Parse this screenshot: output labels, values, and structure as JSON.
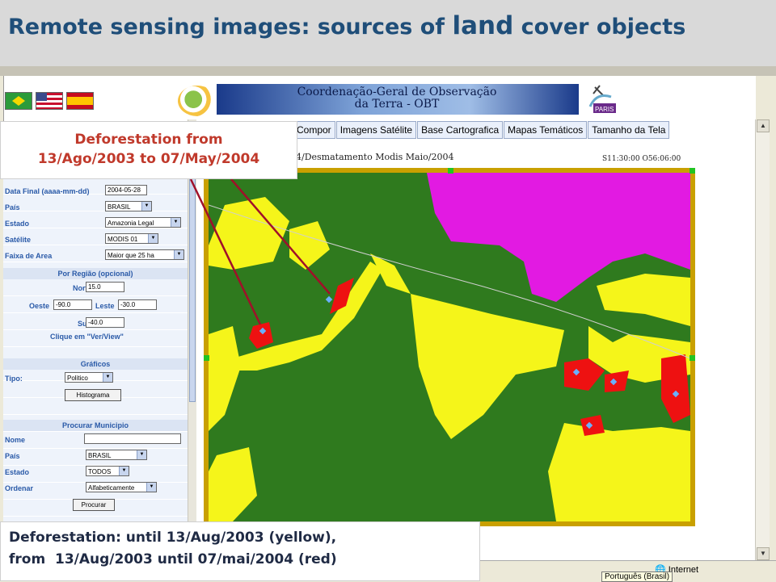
{
  "slide": {
    "title_part1": "Remote sensing images: sources of ",
    "title_land": "land",
    "title_part2": " cover objects"
  },
  "app": {
    "banner_line1": "Coordenação-Geral de Observação",
    "banner_line2": "da Terra - OBT",
    "sat_logo_text": "PARIS",
    "menu_tabs": [
      "Compor",
      "Imagens Satélite",
      "Base Cartografica",
      "Mapas Temáticos",
      "Tamanho da Tela"
    ],
    "map_path": "4/Desmatamento Modis Maio/2004",
    "map_coords": "S11:30:00 O56:06:00"
  },
  "form": {
    "data_final_label": "Data Final (aaaa-mm-dd)",
    "data_final_value": "2004-05-28",
    "pais_label": "País",
    "pais_value": "BRASIL",
    "estado_label": "Estado",
    "estado_value": "Amazonia Legal",
    "satelite_label": "Satélite",
    "satelite_value": "MODIS 01",
    "faixa_label": "Faixa de Area",
    "faixa_value": "Maior que 25 ha",
    "regiao_header": "Por Região (opcional)",
    "norte_label": "Norte",
    "norte_value": "15.0",
    "oeste_label": "Oeste",
    "oeste_value": "-90.0",
    "leste_label": "Leste",
    "leste_value": "-30.0",
    "sul_label": "Sul",
    "sul_value": "-40.0",
    "clique_link": "Clique em \"Ver/View\"",
    "graficos_header": "Gráficos",
    "tipo_label": "Tipo:",
    "tipo_value": "Politico",
    "histograma_button": "Histograma",
    "municipio_header": "Procurar Municipio",
    "nome_label": "Nome",
    "nome_value": "",
    "pais2_label": "País",
    "pais2_value": "BRASIL",
    "estado2_label": "Estado",
    "estado2_value": "TODOS",
    "ordenar_label": "Ordenar",
    "ordenar_value": "Alfabeticamente",
    "procurar_button": "Procurar"
  },
  "callouts": {
    "top_line1": "Deforestation from",
    "top_line2": "13/Ago/2003 to 07/May/2004",
    "bottom_line1": "Deforestation: until 13/Aug/2003 (yellow),",
    "bottom_line2": "from  13/Aug/2003 until 07/mai/2004 (red)"
  },
  "status": {
    "zone": "Internet",
    "language": "Português (Brasil)"
  },
  "colors": {
    "forest": "#2f7a1e",
    "deforested_until_2003": "#f5f51a",
    "deforested_2003_2004": "#ee1111",
    "cloud_mask": "#e21ae2",
    "frame": "#c9a000",
    "title": "#1f4e79",
    "callout_red": "#c0392b"
  }
}
